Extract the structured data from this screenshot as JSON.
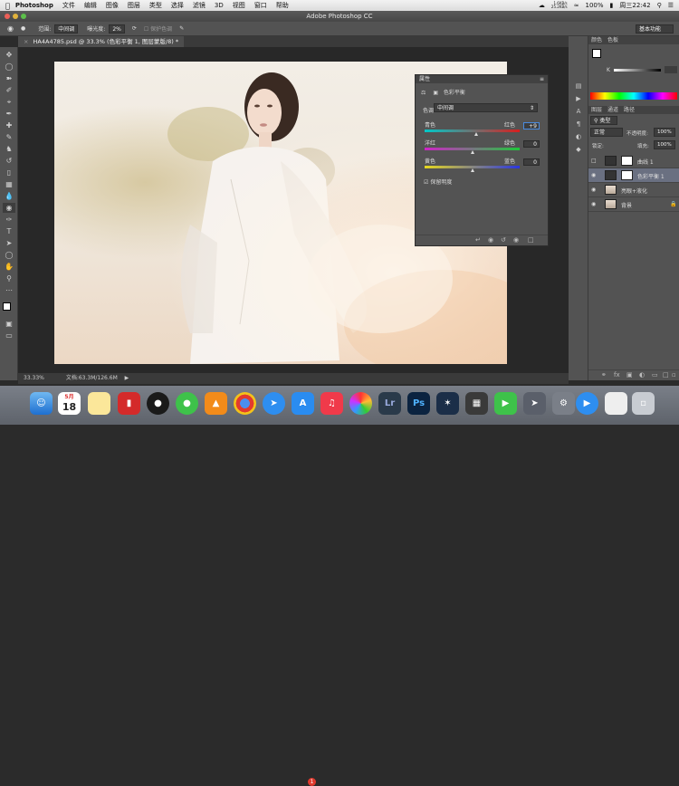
{
  "menubar": {
    "app": "Photoshop",
    "items": [
      "文件",
      "编辑",
      "图像",
      "图层",
      "类型",
      "选择",
      "滤镜",
      "3D",
      "视图",
      "窗口",
      "帮助"
    ],
    "battery": "100%",
    "clock": "周三22:42",
    "net_up": "1.6KB/s",
    "net_down": "25.2KB/s"
  },
  "window": {
    "title": "Adobe Photoshop CC"
  },
  "options": {
    "range_label": "范围:",
    "range_value": "中间调",
    "exposure_label": "曝光度:",
    "exposure_value": "2%",
    "protect_label": "保护色调",
    "workspace": "基本功能"
  },
  "document": {
    "tab": "HA4A4785.psd @ 33.3% (色彩平衡 1, 图层蒙版/8) *",
    "zoom": "33.33%",
    "doc_size": "文档:63.3M/126.6M"
  },
  "properties": {
    "title": "属性",
    "adjust_name": "色彩平衡",
    "tone_label": "色调:",
    "tone_value": "中间调",
    "rows": [
      {
        "left": "青色",
        "right": "红色",
        "value": "+9",
        "pos": 0.54
      },
      {
        "left": "洋红",
        "right": "绿色",
        "value": "0",
        "pos": 0.5
      },
      {
        "left": "黄色",
        "right": "蓝色",
        "value": "0",
        "pos": 0.5
      }
    ],
    "preserve": "保留明度"
  },
  "panels": {
    "color_tabs": [
      "颜色",
      "色板"
    ],
    "k_label": "K",
    "layer_tabs": [
      "图层",
      "通道",
      "路径"
    ],
    "kind": "类型",
    "blend": "正常",
    "opacity_label": "不透明度:",
    "opacity": "100%",
    "lock_label": "锁定:",
    "fill_label": "填充:",
    "fill": "100%",
    "layers": [
      "曲线 1",
      "色彩平衡 1",
      "亮眼+液化",
      "背景"
    ]
  },
  "dock": {
    "calendar_day": "18",
    "calendar_month": "5月",
    "appstore_badge": "1",
    "lr": "Lr",
    "ps": "Ps"
  }
}
